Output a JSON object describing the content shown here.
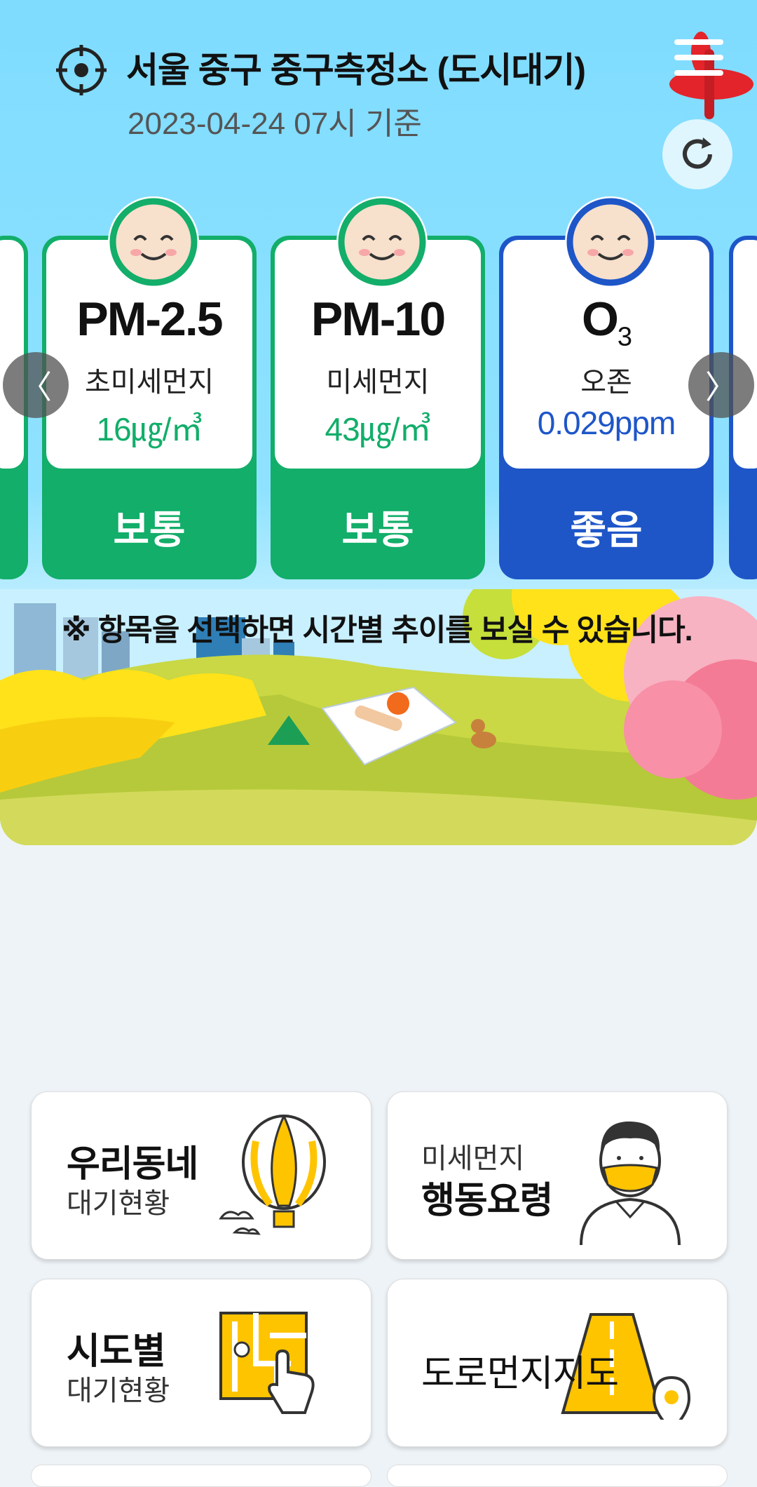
{
  "header": {
    "station": "서울 중구 중구측정소 (도시대기)",
    "datetime": "2023-04-24 07시 기준"
  },
  "cards": [
    {
      "name": "PM-2.5",
      "kname": "초미세먼지",
      "value": "16㎍/㎥",
      "grade": "보통"
    },
    {
      "name": "PM-10",
      "kname": "미세먼지",
      "value": "43㎍/㎥",
      "grade": "보통"
    },
    {
      "name": "O",
      "sub": "3",
      "kname": "오존",
      "value": "0.029ppm",
      "grade": "좋음"
    }
  ],
  "arrows": {
    "prev": "〈",
    "next": "〉"
  },
  "notice": "※ 항목을 선택하면 시간별 추이를 보실 수 있습니다.",
  "tiles": [
    {
      "big": "우리동네",
      "small": "대기현황"
    },
    {
      "small": "미세먼지",
      "big": "행동요령"
    },
    {
      "big": "시도별",
      "small": "대기현황"
    },
    {
      "big": "도로먼지지도"
    }
  ],
  "colors": {
    "normal": "#12ae6a",
    "good": "#1e56c8",
    "sky": "#7fdcff"
  }
}
